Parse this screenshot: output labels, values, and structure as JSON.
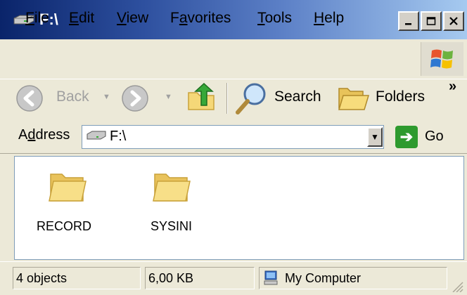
{
  "window": {
    "title": "F:\\"
  },
  "menu": [
    {
      "id": "file",
      "pre": "",
      "u": "F",
      "post": "ile"
    },
    {
      "id": "edit",
      "pre": "",
      "u": "E",
      "post": "dit"
    },
    {
      "id": "view",
      "pre": "",
      "u": "V",
      "post": "iew"
    },
    {
      "id": "favorites",
      "pre": "F",
      "u": "a",
      "post": "vorites"
    },
    {
      "id": "tools",
      "pre": "",
      "u": "T",
      "post": "ools"
    },
    {
      "id": "help",
      "pre": "",
      "u": "H",
      "post": "elp"
    }
  ],
  "toolbar": {
    "back": "Back",
    "search": "Search",
    "folders": "Folders",
    "more": "»"
  },
  "address": {
    "pre": "A",
    "u": "d",
    "post": "dress",
    "value": "F:\\",
    "go": "Go"
  },
  "items": [
    {
      "name": "RECORD"
    },
    {
      "name": "SYSINI"
    }
  ],
  "status": {
    "objects": "4 objects",
    "size": "6,00 KB",
    "location": "My Computer"
  },
  "colors": {
    "titlebar_start": "#0a246a",
    "titlebar_end": "#a6caf0",
    "chrome": "#ece9d8",
    "folder": "#f5d878"
  }
}
